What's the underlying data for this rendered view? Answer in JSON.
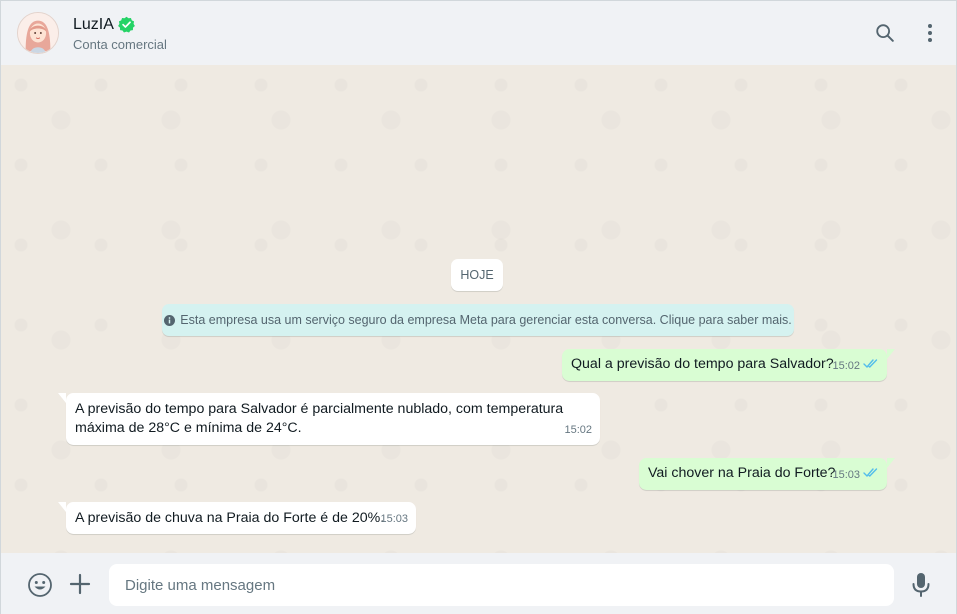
{
  "header": {
    "name": "LuzIA",
    "subtitle": "Conta comercial",
    "icons": [
      "avatar",
      "verified-badge-icon",
      "search-icon",
      "menu-dots-icon"
    ]
  },
  "chat": {
    "date_chip": "HOJE",
    "system_message": "Esta empresa usa um serviço seguro da empresa Meta para gerenciar esta conversa. Clique para saber mais.",
    "messages": [
      {
        "direction": "out",
        "text": "Qual a previsão do tempo para Salvador?",
        "time": "15:02",
        "status": "read"
      },
      {
        "direction": "in",
        "text": "A previsão do tempo para Salvador é parcialmente nublado, com temperatura máxima de 28°C e mínima de 24°C.",
        "time": "15:02"
      },
      {
        "direction": "out",
        "text": "Vai chover na Praia do Forte?",
        "time": "15:03",
        "status": "read"
      },
      {
        "direction": "in",
        "text": "A previsão de chuva na Praia do Forte é de 20%.",
        "time": "15:03"
      }
    ]
  },
  "footer": {
    "input_placeholder": "Digite uma mensagem",
    "icons": [
      "emoji-icon",
      "plus-icon",
      "mic-icon"
    ]
  },
  "colors": {
    "outgoing_bubble": "#d9fdd3",
    "incoming_bubble": "#ffffff",
    "system_bubble": "#d5f2f0",
    "chat_background": "#efeae2",
    "header_background": "#f0f2f5",
    "verified": "#25d366",
    "read_ticks": "#53bdeb"
  }
}
